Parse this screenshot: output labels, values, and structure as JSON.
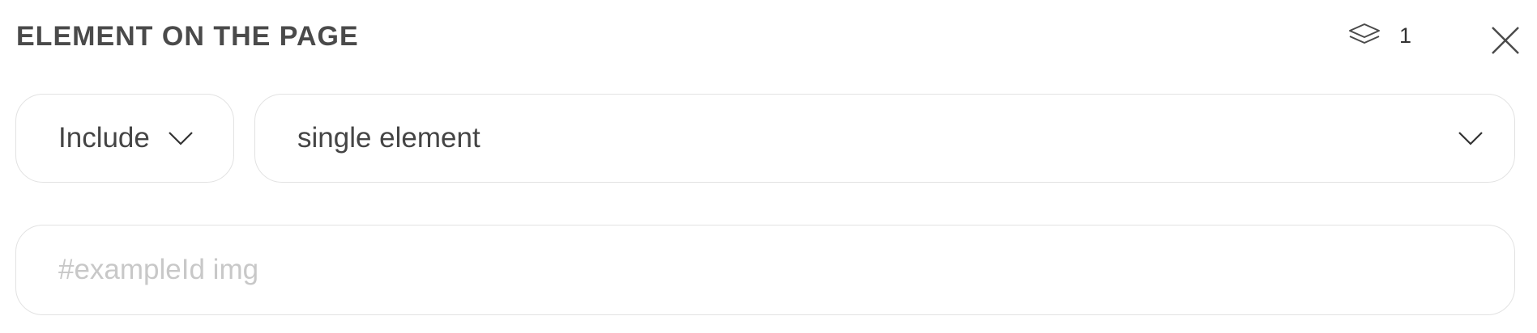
{
  "header": {
    "title": "ELEMENT ON THE PAGE",
    "layers_icon": "layers-icon",
    "layer_count": "1",
    "close_icon": "close-icon"
  },
  "filters": {
    "include_select": {
      "value": "Include",
      "icon": "chevron-down-icon"
    },
    "type_select": {
      "value": "single element",
      "icon": "chevron-down-icon"
    }
  },
  "selector_input": {
    "value": "",
    "placeholder": "#exampleId img"
  }
}
